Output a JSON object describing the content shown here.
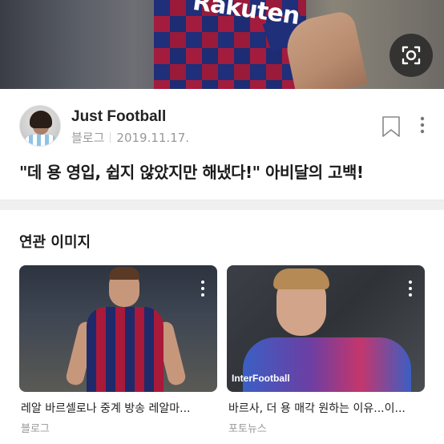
{
  "hero": {
    "sponsor_text": "Rakuten",
    "camera_button": "camera-search-icon"
  },
  "post": {
    "author": "Just Football",
    "source": "블로그",
    "date": "2019.11.17.",
    "title": "\"데 용 영입, 쉽지 않았지만 해냈다!\" 아비달의 고백!",
    "icons": {
      "bookmark": "bookmark-icon",
      "more": "more-vertical-icon"
    }
  },
  "related": {
    "section_title": "연관 이미지",
    "items": [
      {
        "caption": "레알 바르셀로나 중계 방송 레알마...",
        "source": "블로그",
        "watermark": ""
      },
      {
        "caption": "바르사, 더 용 매각 원하는 이유...이...",
        "source": "포토뉴스",
        "watermark": "InterFootball"
      }
    ]
  },
  "colors": {
    "text_primary": "#1a1a1a",
    "text_secondary": "#999999",
    "divider": "#f0f0f0"
  }
}
